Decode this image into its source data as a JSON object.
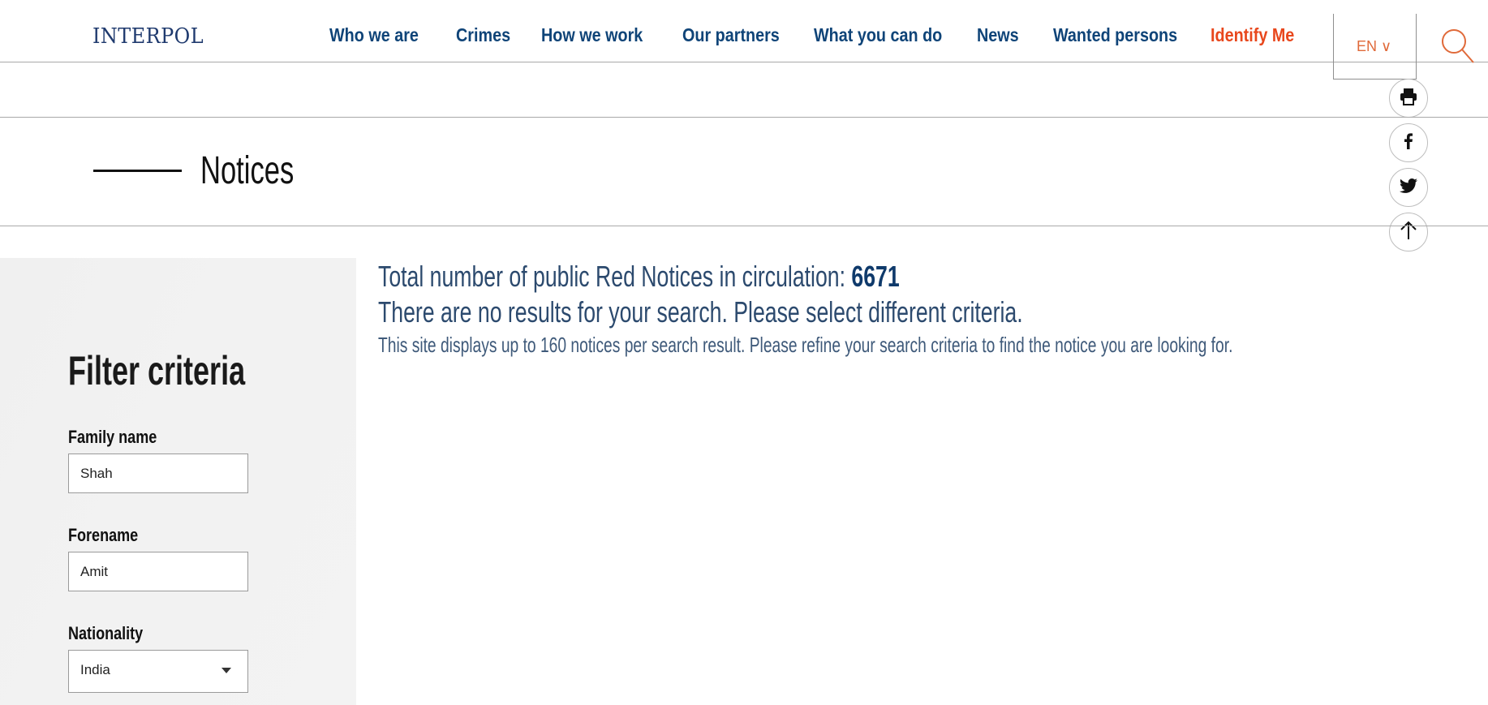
{
  "header": {
    "logo": "INTERPOL",
    "nav": [
      {
        "label": "Who we are"
      },
      {
        "label": "Crimes"
      },
      {
        "label": "How we work"
      },
      {
        "label": "Our partners"
      },
      {
        "label": "What you can do"
      },
      {
        "label": "News"
      },
      {
        "label": "Wanted persons"
      },
      {
        "label": "Identify Me"
      }
    ],
    "language": "EN ∨",
    "search_icon": "search-icon"
  },
  "share": {
    "icons": [
      "print-icon",
      "facebook-icon",
      "twitter-icon",
      "arrow-up-icon"
    ]
  },
  "page": {
    "title": "Notices"
  },
  "filter": {
    "title": "Filter criteria",
    "family_name": {
      "label": "Family name",
      "value": "Shah"
    },
    "forename": {
      "label": "Forename",
      "value": "Amit"
    },
    "nationality": {
      "label": "Nationality",
      "value": "India"
    }
  },
  "results": {
    "total_prefix": "Total number of public Red Notices in circulation: ",
    "total_count": "6671",
    "no_results": "There are no results for your search. Please select different criteria.",
    "info": "This site displays up to 160 notices per search result. Please refine your search criteria to find the notice you are looking for."
  },
  "colors": {
    "brand_navy": "#0f4478",
    "accent_orange": "#e8471c",
    "text_body": "#2c4a6e",
    "sidebar_bg": "#f1f1f1"
  }
}
